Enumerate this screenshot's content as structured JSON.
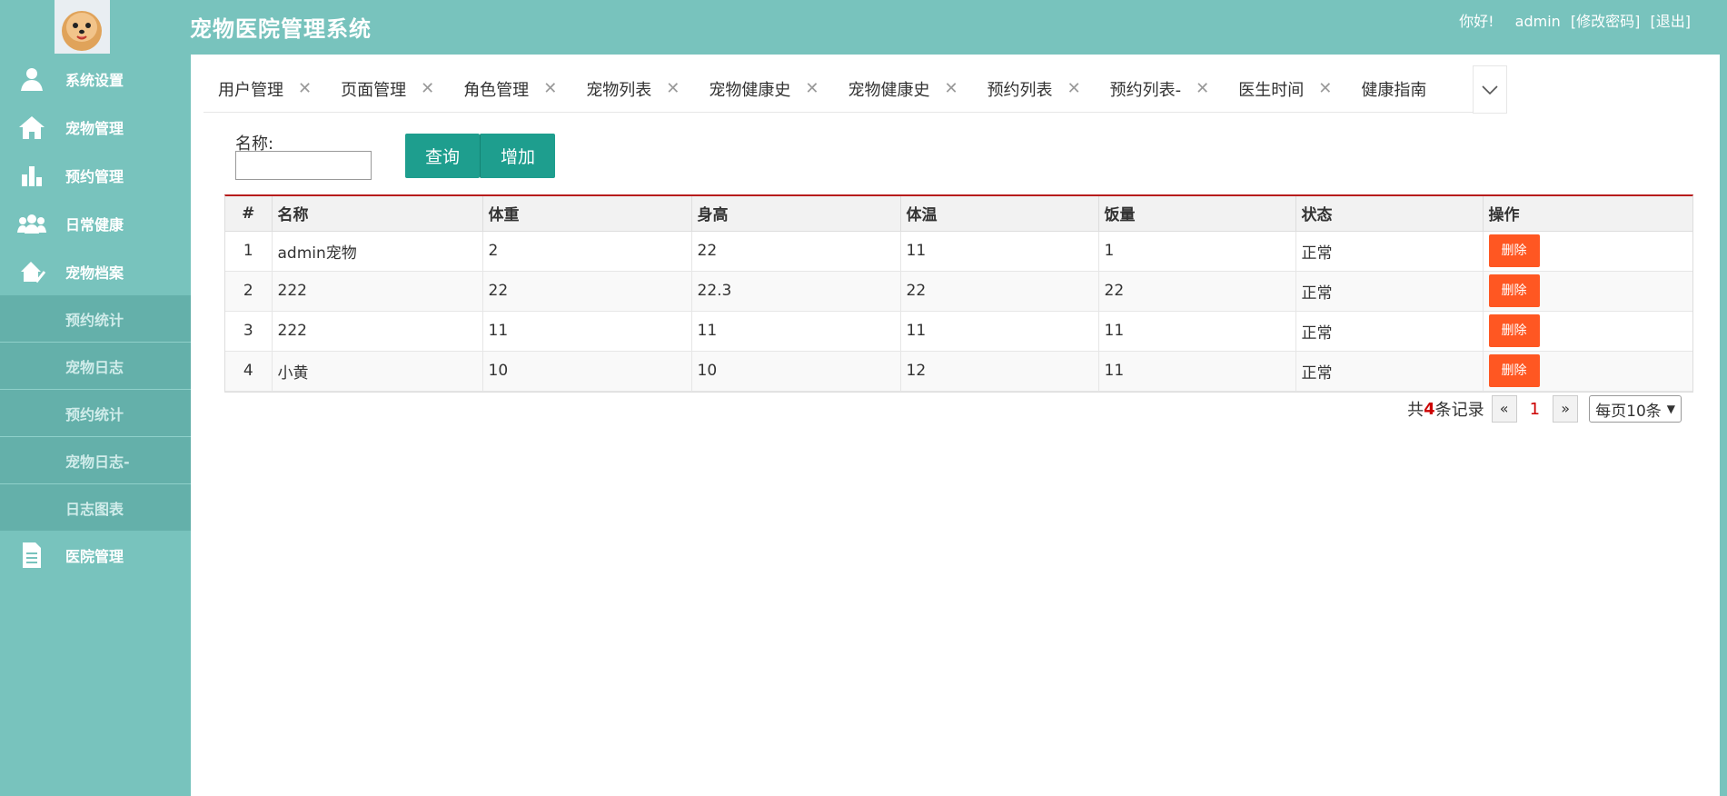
{
  "header": {
    "title": "宠物医院管理系统",
    "greeting": "你好!",
    "username": "admin",
    "change_password": "[修改密码]",
    "logout": "[退出]"
  },
  "sidebar": {
    "items": [
      {
        "label": "系统设置",
        "icon": "user-icon"
      },
      {
        "label": "宠物管理",
        "icon": "home-icon"
      },
      {
        "label": "预约管理",
        "icon": "bar-chart-icon"
      },
      {
        "label": "日常健康",
        "icon": "group-icon"
      },
      {
        "label": "宠物档案",
        "icon": "pet-record-icon"
      }
    ],
    "sub_items": [
      {
        "label": "预约统计"
      },
      {
        "label": "宠物日志"
      },
      {
        "label": "预约统计"
      },
      {
        "label": "宠物日志-"
      },
      {
        "label": "日志图表"
      }
    ],
    "last_item": {
      "label": "医院管理",
      "icon": "document-icon"
    }
  },
  "tabs": [
    {
      "label": "用户管理"
    },
    {
      "label": "页面管理"
    },
    {
      "label": "角色管理"
    },
    {
      "label": "宠物列表"
    },
    {
      "label": "宠物健康史"
    },
    {
      "label": "宠物健康史"
    },
    {
      "label": "预约列表"
    },
    {
      "label": "预约列表-"
    },
    {
      "label": "医生时间"
    },
    {
      "label": "健康指南"
    }
  ],
  "search": {
    "label": "名称:",
    "value": "",
    "query_button": "查询",
    "add_button": "增加"
  },
  "table": {
    "headers": [
      "#",
      "名称",
      "体重",
      "身高",
      "体温",
      "饭量",
      "状态",
      "操作"
    ],
    "rows": [
      {
        "idx": "1",
        "name": "admin宠物",
        "weight": "2",
        "height": "22",
        "temp": "11",
        "food": "1",
        "status": "正常",
        "action": "删除"
      },
      {
        "idx": "2",
        "name": "222",
        "weight": "22",
        "height": "22.3",
        "temp": "22",
        "food": "22",
        "status": "正常",
        "action": "删除"
      },
      {
        "idx": "3",
        "name": "222",
        "weight": "11",
        "height": "11",
        "temp": "11",
        "food": "11",
        "status": "正常",
        "action": "删除"
      },
      {
        "idx": "4",
        "name": "小黄",
        "weight": "10",
        "height": "10",
        "temp": "12",
        "food": "11",
        "status": "正常",
        "action": "删除"
      }
    ]
  },
  "pagination": {
    "prefix": "共",
    "total": "4",
    "suffix": "条记录",
    "prev": "«",
    "current_page": "1",
    "next": "»",
    "page_size": "每页10条"
  },
  "colors": {
    "primary_teal": "#78c3bd",
    "button_teal": "#1e9e8e",
    "danger": "#ff5722",
    "accent_red": "#b71c1c"
  }
}
